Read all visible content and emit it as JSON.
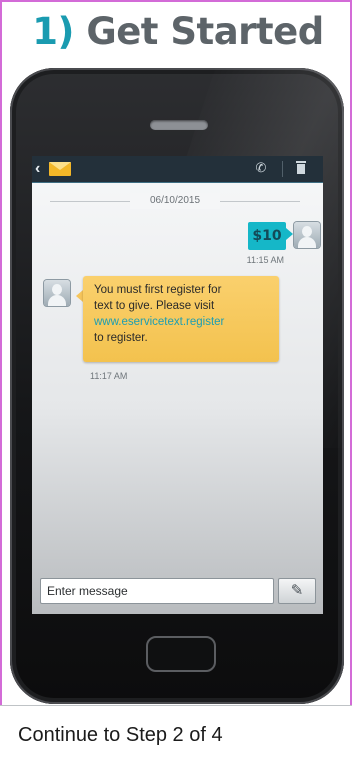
{
  "step": {
    "number": "1)",
    "title": "Get Started"
  },
  "screen": {
    "date": "06/10/2015",
    "outgoing": {
      "text": "$10",
      "time": "11:15 AM"
    },
    "incoming": {
      "line1": "You must first register for",
      "line2": "text to give. Please visit",
      "link": "www.eservicetext.register",
      "line4": "to register.",
      "time": "11:17 AM"
    },
    "composer": {
      "placeholder": "Enter message"
    }
  },
  "icons": {
    "back": "back-arrow-icon",
    "mail": "envelope-icon",
    "call": "phone-icon",
    "delete": "trash-icon",
    "attach": "paperclip-icon"
  },
  "colors": {
    "accent": "#1a9bb0",
    "outgoing_bubble": "#15b7c8",
    "incoming_bubble": "#f3c24e",
    "border": "#d36bd7"
  },
  "footer": {
    "link_text": "Continue to Step 2 of 4"
  }
}
